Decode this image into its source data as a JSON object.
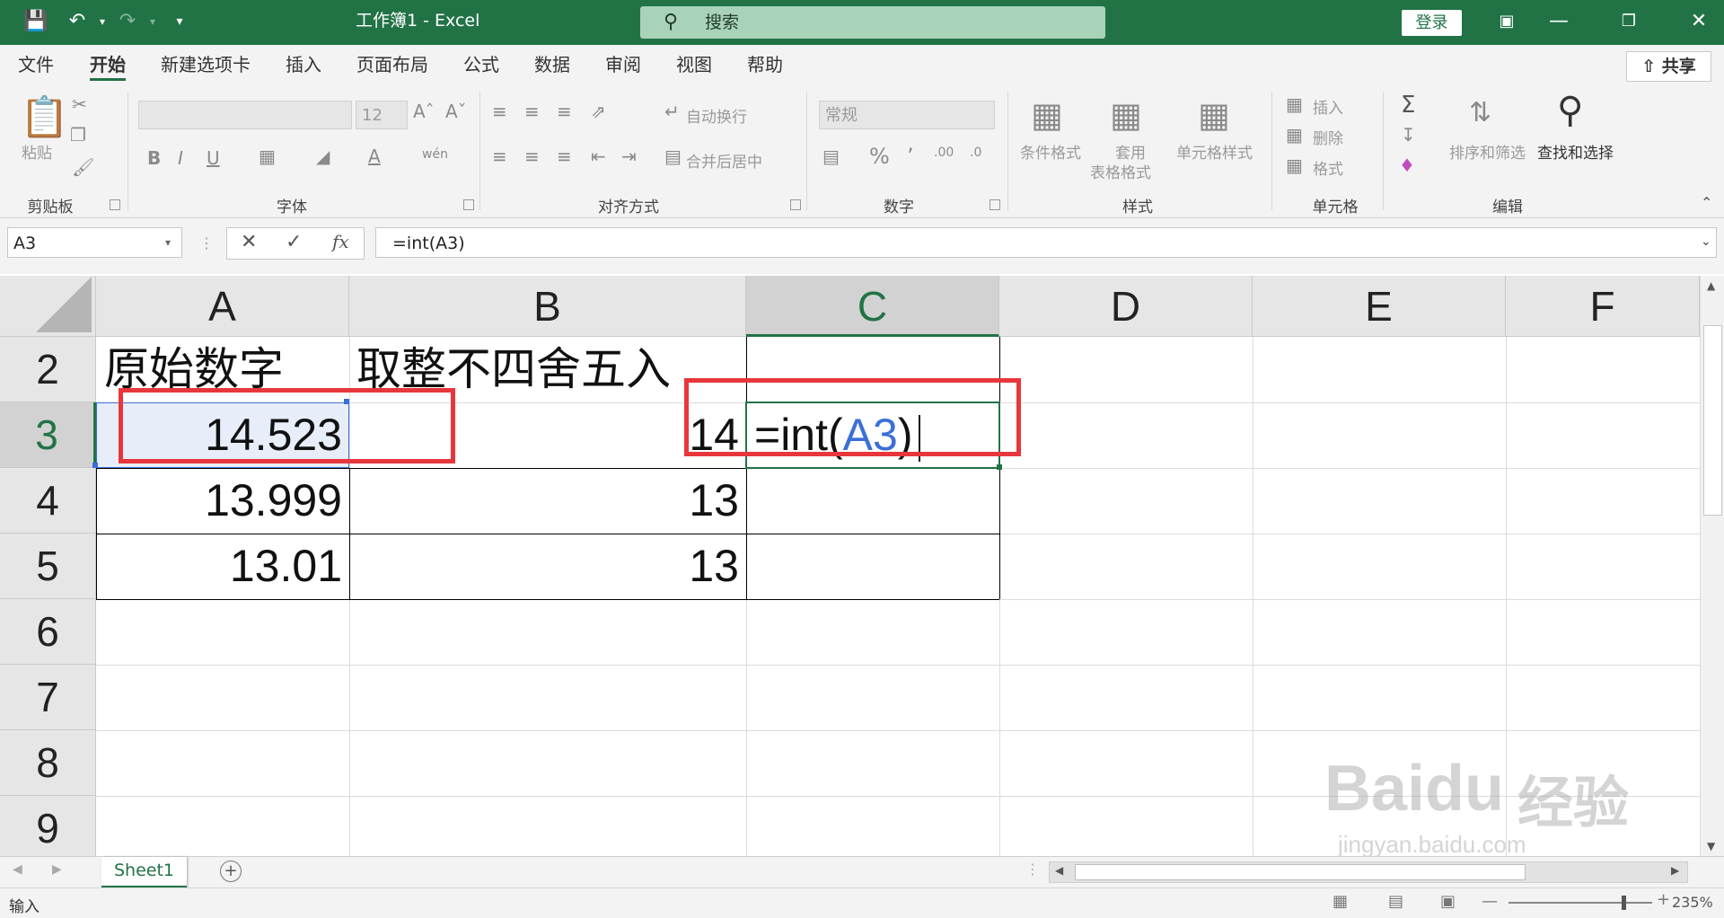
{
  "titlebar": {
    "title": "工作簿1 - Excel",
    "search_label": "搜索",
    "login_label": "登录"
  },
  "tabs": [
    "文件",
    "开始",
    "新建选项卡",
    "插入",
    "页面布局",
    "公式",
    "数据",
    "审阅",
    "视图",
    "帮助"
  ],
  "active_tab": "开始",
  "share_label": "共享",
  "ribbon": {
    "clipboard": {
      "paste": "粘贴",
      "group": "剪贴板"
    },
    "font": {
      "size": "12",
      "group": "字体"
    },
    "alignment": {
      "wrap": "自动换行",
      "merge": "合并后居中",
      "group": "对齐方式"
    },
    "number": {
      "format": "常规",
      "group": "数字"
    },
    "styles": {
      "conditional": "条件格式",
      "table_line1": "套用",
      "table_line2": "表格格式",
      "cell_styles": "单元格样式",
      "group": "样式"
    },
    "cells": {
      "insert": "插入",
      "delete": "删除",
      "format": "格式",
      "group": "单元格"
    },
    "editing": {
      "sort": "排序和筛选",
      "find": "查找和选择",
      "group": "编辑"
    }
  },
  "formula_bar": {
    "name_box": "A3",
    "formula": "=int(A3)"
  },
  "grid": {
    "columns": [
      "A",
      "B",
      "C",
      "D",
      "E",
      "F"
    ],
    "selected_column": "C",
    "rows": [
      "2",
      "3",
      "4",
      "5",
      "6",
      "7",
      "8",
      "9"
    ],
    "selected_row": "3",
    "cells": {
      "A2": "原始数字",
      "B2": "取整不四舍五入",
      "A3": "14.523",
      "B3": "14",
      "A4": "13.999",
      "B4": "13",
      "A5": "13.01",
      "B5": "13",
      "C3_prefix": "=int(",
      "C3_ref": "A3",
      "C3_suffix": ")"
    }
  },
  "sheets": [
    "Sheet1"
  ],
  "status": {
    "mode": "输入",
    "zoom": "235%"
  },
  "watermark": {
    "brand": "Baidu",
    "suffix": "经验",
    "url": "jingyan.baidu.com"
  },
  "colors": {
    "excel_green": "#217346",
    "highlight_red": "#e8373c",
    "ref_blue": "#3a6fd8"
  }
}
